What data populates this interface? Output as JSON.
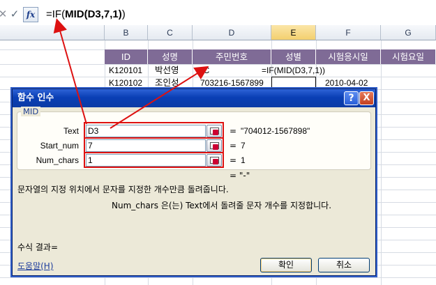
{
  "formula_bar": {
    "cancel_icon": "x-icon",
    "enter_icon": "check-icon",
    "fx_label": "fx",
    "formula_pre": "=IF(",
    "formula_bold": "MID(D3,7,1)",
    "formula_post": ")"
  },
  "sheet": {
    "columns": [
      "B",
      "C",
      "D",
      "E",
      "F",
      "G"
    ],
    "selected_column": "E",
    "headers": [
      "ID",
      "성명",
      "주민번호",
      "성별",
      "시험응시일",
      "시험요일"
    ],
    "header_color": "#7f6b96",
    "rows": [
      {
        "id": "K120101",
        "name": "박선영",
        "ssn": "7C",
        "gender_formula": "=IF(MID(D3,7,1))",
        "date": ""
      },
      {
        "id": "K120102",
        "name": "조인성",
        "ssn": "703216-1567899",
        "gender_formula": "",
        "date": "2010-04-02"
      }
    ]
  },
  "dialog": {
    "title": "함수 인수",
    "help_button": "?",
    "close_button": "X",
    "group_label": "MID",
    "args": [
      {
        "label": "Text",
        "value": "D3",
        "result": "\"704012-1567898\""
      },
      {
        "label": "Start_num",
        "value": "7",
        "result": "7"
      },
      {
        "label": "Num_chars",
        "value": "1",
        "result": "1"
      }
    ],
    "equals": "=",
    "overall_result": "\"-\"",
    "description": "문자열의 지정 위치에서 문자를 지정한 개수만큼 돌려줍니다.",
    "arg_description": "Num_chars  은(는) Text에서 돌려줄 문자 개수를 지정합니다.",
    "result_label": "수식 결과=",
    "help_link": "도움말(H)",
    "ok_button": "확인",
    "cancel_button": "취소"
  },
  "colors": {
    "annotation_red": "#dd1111",
    "title_blue": "#0a3fb5"
  }
}
